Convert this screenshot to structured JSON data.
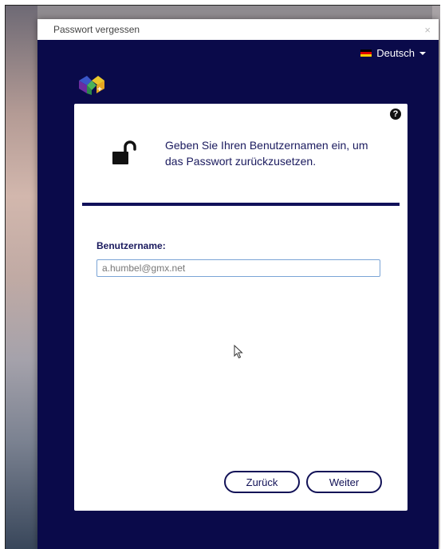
{
  "window": {
    "title": "Passwort vergessen",
    "close_glyph": "×"
  },
  "language": {
    "selected": "Deutsch",
    "flag_icon": "german-flag-icon"
  },
  "card": {
    "help_glyph": "?",
    "instruction": "Geben Sie Ihren Benutzernamen ein, um das Passwort zurückzusetzen.",
    "field_label": "Benutzername:",
    "username_value": "a.humbel@gmx.net"
  },
  "buttons": {
    "back": "Zurück",
    "next": "Weiter"
  },
  "colors": {
    "dialog_bg": "#0a0a4a",
    "accent": "#121257",
    "input_border": "#7aa4d6"
  }
}
